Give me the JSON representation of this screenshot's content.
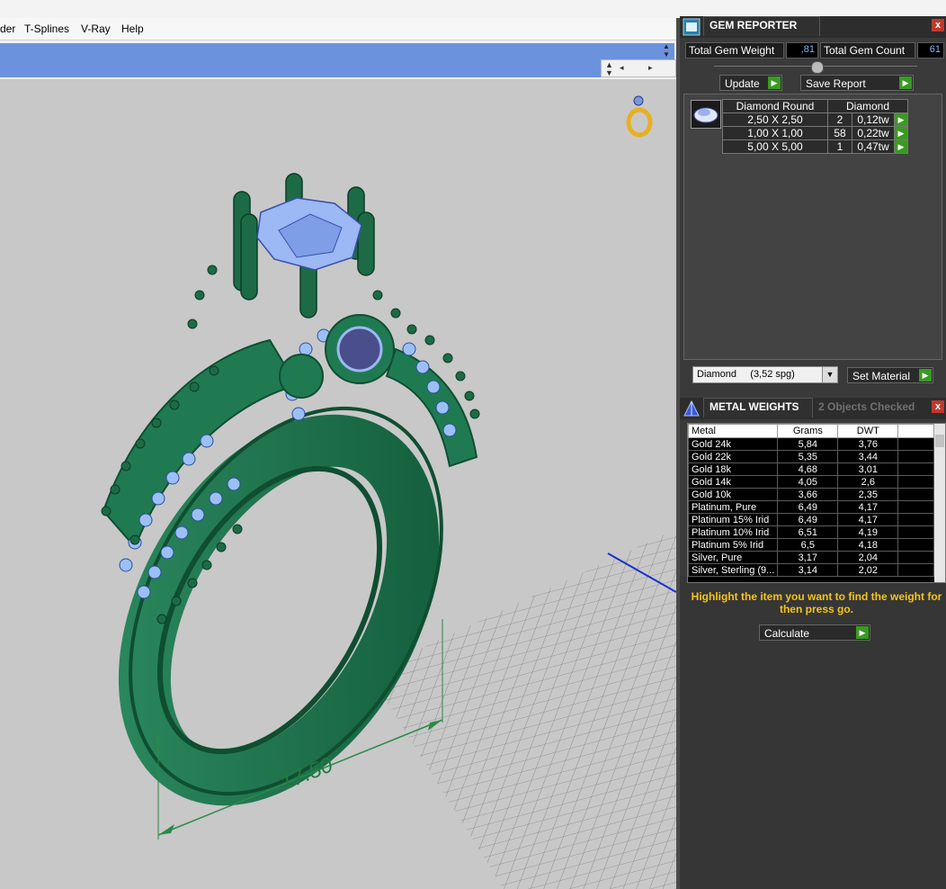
{
  "menu": {
    "items": [
      "der",
      "T-Splines",
      "V-Ray",
      "Help"
    ]
  },
  "scroll_controls": {
    "up": "▲",
    "down": "▼",
    "left": "◂",
    "right": "▸"
  },
  "viewport": {
    "dimension_label": "17.50"
  },
  "gem_reporter": {
    "title": "GEM REPORTER",
    "close": "x",
    "total_gem_weight_label": "Total Gem Weight",
    "total_gem_weight": ",81",
    "total_gem_count_label": "Total Gem Count",
    "total_gem_count": "61",
    "update_label": "Update",
    "save_report_label": "Save Report",
    "table": {
      "headers": [
        "Diamond Round",
        "Diamond"
      ],
      "rows": [
        {
          "size": "2,50 X 2,50",
          "count": "2",
          "weight": "0,12tw"
        },
        {
          "size": "1,00 X 1,00",
          "count": "58",
          "weight": "0,22tw"
        },
        {
          "size": "5,00 X 5,00",
          "count": "1",
          "weight": "0,47tw"
        }
      ]
    },
    "material_select": "Diamond     (3,52 spg)",
    "set_material_label": "Set Material"
  },
  "metal_weights": {
    "title": "METAL WEIGHTS",
    "status": "2 Objects Checked",
    "close": "x",
    "columns": [
      "Metal",
      "Grams",
      "DWT"
    ],
    "rows": [
      {
        "metal": "Gold 24k",
        "grams": "5,84",
        "dwt": "3,76"
      },
      {
        "metal": "Gold 22k",
        "grams": "5,35",
        "dwt": "3,44"
      },
      {
        "metal": "Gold 18k",
        "grams": "4,68",
        "dwt": "3,01"
      },
      {
        "metal": "Gold 14k",
        "grams": "4,05",
        "dwt": "2,6"
      },
      {
        "metal": "Gold 10k",
        "grams": "3,66",
        "dwt": "2,35"
      },
      {
        "metal": "Platinum, Pure",
        "grams": "6,49",
        "dwt": "4,17"
      },
      {
        "metal": "Platinum 15% Irid",
        "grams": "6,49",
        "dwt": "4,17"
      },
      {
        "metal": "Platinum 10% Irid",
        "grams": "6,51",
        "dwt": "4,19"
      },
      {
        "metal": "Platinum 5% Irid",
        "grams": "6,5",
        "dwt": "4,18"
      },
      {
        "metal": "Silver, Pure",
        "grams": "3,17",
        "dwt": "2,04"
      },
      {
        "metal": "Silver, Sterling (9...",
        "grams": "3,14",
        "dwt": "2,02"
      }
    ],
    "hint": "Highlight the item you want to find the weight for then press go.",
    "calculate_label": "Calculate"
  },
  "colors": {
    "ring_green": "#1e6e4a",
    "gem_blue": "#8fb2f0",
    "selection_blue": "#6b92dd",
    "go_green": "#3a9a22",
    "hint_yellow": "#f5c518"
  }
}
